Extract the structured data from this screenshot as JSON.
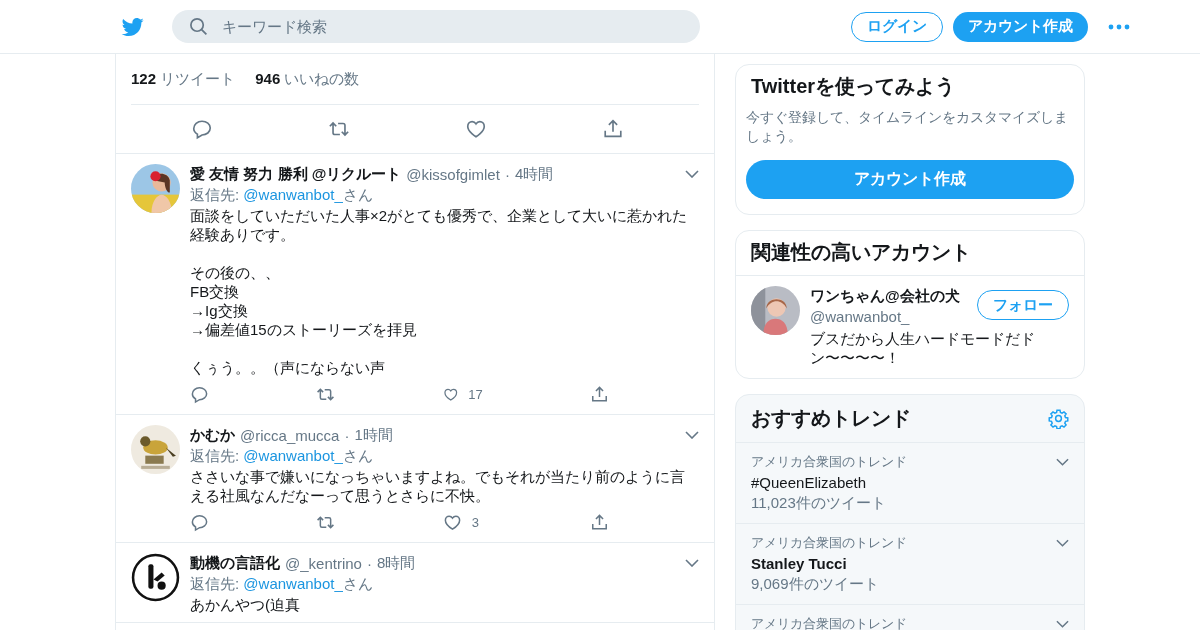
{
  "header": {
    "search": {
      "placeholder": "キーワード検索"
    },
    "login_button": "ログイン",
    "signup_button": "アカウント作成"
  },
  "main_tweet": {
    "retweets": "122",
    "retweets_label": "リツイート",
    "likes": "946",
    "likes_label": "いいねの数"
  },
  "replies": [
    {
      "name": "愛 友情 努力 勝利 @リクルート",
      "handle": "@kissofgimlet",
      "separator": "·",
      "time": "4時間",
      "reply_label": "返信先:",
      "reply_to": "@wanwanbot_",
      "reply_suffix": "さん",
      "paragraphs": [
        [
          "面談をしていただいた人事×2がとても優秀で、企業として大いに惹かれた経験ありです。"
        ],
        [
          "その後の、、",
          "FB交換",
          "→Ig交換",
          "→偏差値15のストーリーズを拝見"
        ],
        [
          "くぅう。。（声にならない声"
        ]
      ],
      "likes": "17"
    },
    {
      "name": "かむか",
      "handle": "@ricca_mucca",
      "separator": "·",
      "time": "1時間",
      "reply_label": "返信先:",
      "reply_to": "@wanwanbot_",
      "reply_suffix": "さん",
      "paragraphs": [
        [
          "ささいな事で嫌いになっちゃいますよね。でもそれが当たり前のように言える社風なんだなーって思うとさらに不快。"
        ]
      ],
      "likes": "3"
    },
    {
      "name": "動機の言語化",
      "handle": "@_kentrino",
      "separator": "·",
      "time": "8時間",
      "reply_label": "返信先:",
      "reply_to": "@wanwanbot_",
      "reply_suffix": "さん",
      "paragraphs": [
        [
          "あかんやつ(迫真"
        ]
      ]
    }
  ],
  "signup_card": {
    "title": "Twitterを使ってみよう",
    "text": "今すぐ登録して、タイムラインをカスタマイズしましょう。",
    "button": "アカウント作成"
  },
  "related": {
    "title": "関連性の高いアカウント",
    "accounts": [
      {
        "name": "ワンちゃん@会社の犬",
        "handle": "@wanwanbot_",
        "bio": "ブスだから人生ハードモードだドン〜〜〜〜！",
        "follow_button": "フォロー"
      }
    ]
  },
  "trends": {
    "title": "おすすめトレンド",
    "items": [
      {
        "context": "アメリカ合衆国のトレンド",
        "name": "#QueenElizabeth",
        "kind": "hashtag",
        "count": "11,023件のツイート"
      },
      {
        "context": "アメリカ合衆国のトレンド",
        "name": "Stanley Tucci",
        "kind": "topic",
        "count": "9,069件のツイート"
      },
      {
        "context": "アメリカ合衆国のトレンド"
      }
    ]
  }
}
